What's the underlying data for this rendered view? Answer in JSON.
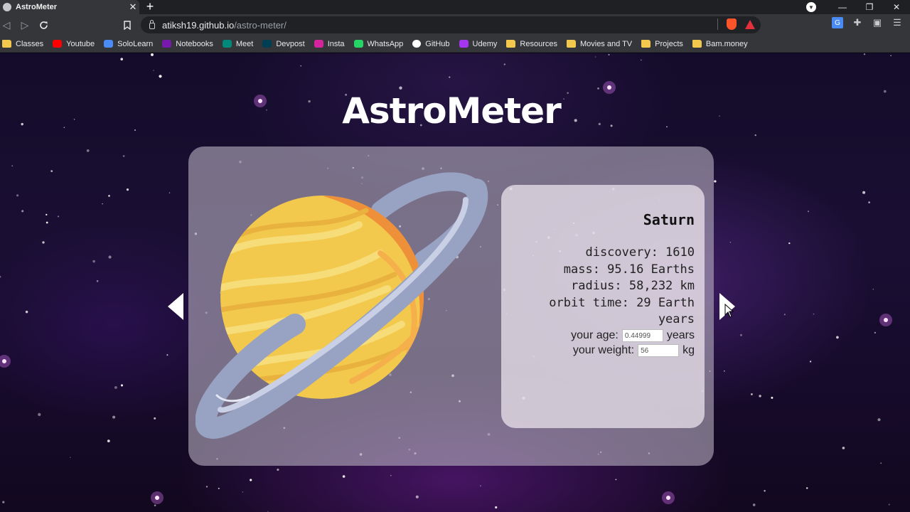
{
  "browser": {
    "tab_title": "AstroMeter",
    "tab_close": "✕",
    "new_tab": "+",
    "url_host": "atiksh19.github.io",
    "url_path": "/astro-meter/",
    "window_controls": {
      "minimize": "—",
      "restore": "❐",
      "close": "✕"
    },
    "bookmarks": [
      {
        "label": "Classes",
        "icon": "folder-icon",
        "color": "#f2c94c"
      },
      {
        "label": "Youtube",
        "icon": "youtube-icon",
        "color": "#ff0000"
      },
      {
        "label": "SoloLearn",
        "icon": "sololearn-icon",
        "color": "#4b8bf5"
      },
      {
        "label": "Notebooks",
        "icon": "onenote-icon",
        "color": "#7719aa"
      },
      {
        "label": "Meet",
        "icon": "meet-icon",
        "color": "#00897b"
      },
      {
        "label": "Devpost",
        "icon": "devpost-icon",
        "color": "#003e54"
      },
      {
        "label": "Insta",
        "icon": "instagram-icon",
        "color": "#d6249f"
      },
      {
        "label": "WhatsApp",
        "icon": "whatsapp-icon",
        "color": "#25d366"
      },
      {
        "label": "GitHub",
        "icon": "github-icon",
        "color": "#ffffff"
      },
      {
        "label": "Udemy",
        "icon": "udemy-icon",
        "color": "#a435f0"
      },
      {
        "label": "Resources",
        "icon": "folder-icon",
        "color": "#f2c94c"
      },
      {
        "label": "Movies and TV",
        "icon": "folder-icon",
        "color": "#f2c94c"
      },
      {
        "label": "Projects",
        "icon": "folder-icon",
        "color": "#f2c94c"
      },
      {
        "label": "Bam.money",
        "icon": "folder-icon",
        "color": "#f2c94c"
      }
    ]
  },
  "page": {
    "title": "AstroMeter",
    "planet": {
      "name": "Saturn",
      "facts": [
        "discovery: 1610",
        "mass: 95.16 Earths",
        "radius: 58,232 km",
        "orbit time: 29 Earth",
        "years"
      ],
      "age_label": "your age:",
      "age_value": "0.44999",
      "age_unit": "years",
      "weight_label": "your weight:",
      "weight_value": "56",
      "weight_unit": "kg"
    },
    "colors": {
      "planet_body": "#f2c94c",
      "planet_shadow": "#ee8f3a",
      "ring": "#98a2c2",
      "ring_light": "#c9cfe4"
    }
  }
}
